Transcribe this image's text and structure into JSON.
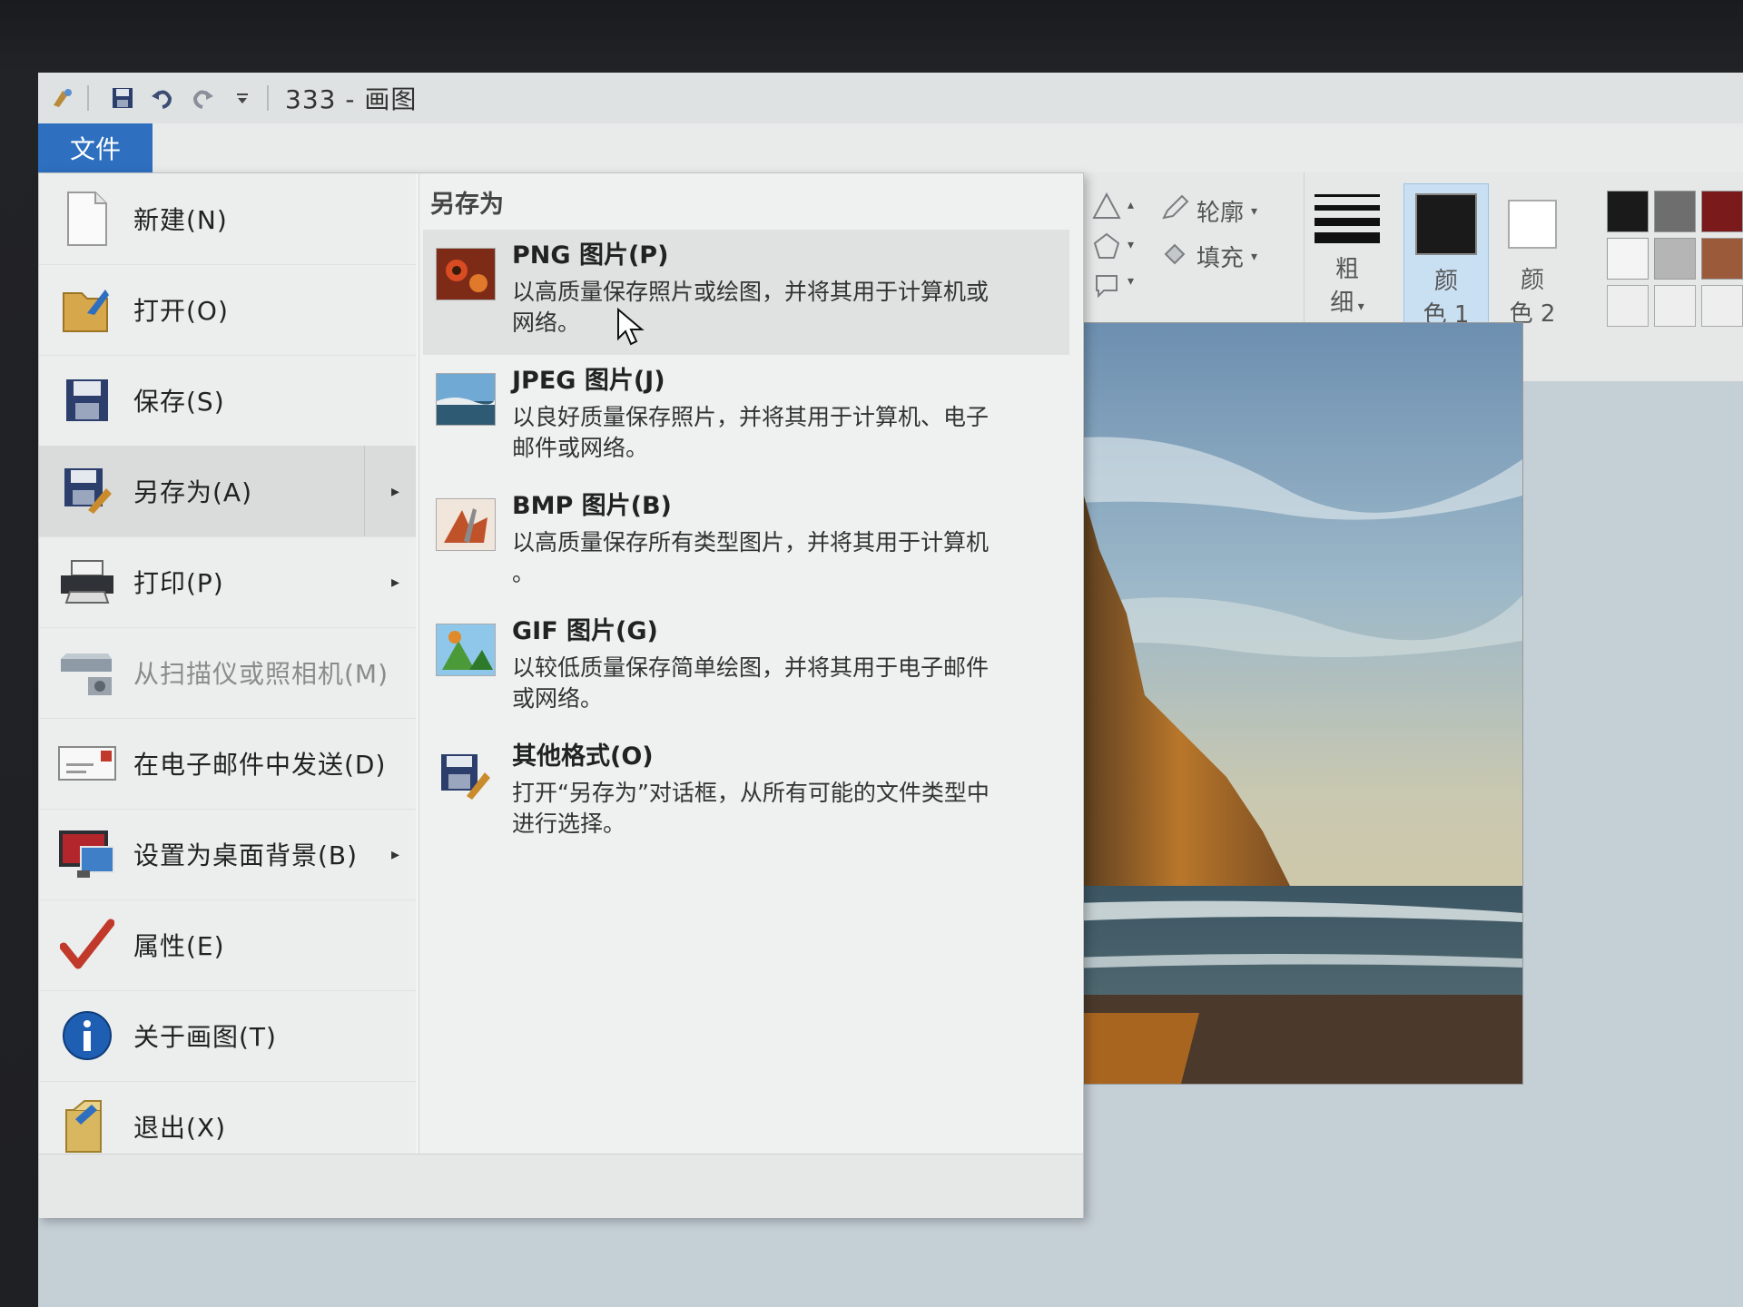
{
  "window": {
    "title": "333 - 画图"
  },
  "ribbon": {
    "file_tab": "文件",
    "outline_label": "轮廓",
    "fill_label": "填充",
    "size_label_1": "粗",
    "size_label_2": "细",
    "color1_label_1": "颜",
    "color1_label_2": "色 1",
    "color2_label_1": "颜",
    "color2_label_2": "色 2",
    "edge_text": "颜",
    "color1_value": "#1a1a1a",
    "color2_value": "#ffffff",
    "palette_row1": [
      "#1a1a1a",
      "#6e6e6e",
      "#7a1a1a",
      "#d9262b"
    ],
    "palette_row2": [
      "#f4f4f4",
      "#b5b5b5",
      "#9b5b3a",
      "#e8a7b5"
    ],
    "palette_row3": [
      "#eeeeee",
      "#eeeeee",
      "#eeeeee",
      "#eeeeee"
    ]
  },
  "file_menu": {
    "items": [
      {
        "label": "新建(N)",
        "icon": "new-document-icon",
        "has_submenu": false,
        "disabled": false
      },
      {
        "label": "打开(O)",
        "icon": "open-folder-icon",
        "has_submenu": false,
        "disabled": false
      },
      {
        "label": "保存(S)",
        "icon": "save-disk-icon",
        "has_submenu": false,
        "disabled": false
      },
      {
        "label": "另存为(A)",
        "icon": "save-as-icon",
        "has_submenu": true,
        "disabled": false
      },
      {
        "label": "打印(P)",
        "icon": "printer-icon",
        "has_submenu": true,
        "disabled": false
      },
      {
        "label": "从扫描仪或照相机(M)",
        "icon": "scanner-icon",
        "has_submenu": false,
        "disabled": true
      },
      {
        "label": "在电子邮件中发送(D)",
        "icon": "email-icon",
        "has_submenu": false,
        "disabled": false
      },
      {
        "label": "设置为桌面背景(B)",
        "icon": "desktop-background-icon",
        "has_submenu": true,
        "disabled": false
      },
      {
        "label": "属性(E)",
        "icon": "checkmark-icon",
        "has_submenu": false,
        "disabled": false
      },
      {
        "label": "关于画图(T)",
        "icon": "info-icon",
        "has_submenu": false,
        "disabled": false
      },
      {
        "label": "退出(X)",
        "icon": "exit-icon",
        "has_submenu": false,
        "disabled": false
      }
    ],
    "arrow_glyph": "▸"
  },
  "save_as": {
    "title": "另存为",
    "formats": [
      {
        "title": "PNG 图片(P)",
        "desc_line1": "以高质量保存照片或绘图，并将其用于计算机或",
        "desc_line2": "网络。",
        "icon": "png-image-icon"
      },
      {
        "title": "JPEG 图片(J)",
        "desc_line1": "以良好质量保存照片，并将其用于计算机、电子",
        "desc_line2": "邮件或网络。",
        "icon": "jpeg-image-icon"
      },
      {
        "title": "BMP 图片(B)",
        "desc_line1": "以高质量保存所有类型图片，并将其用于计算机",
        "desc_line2": "。",
        "icon": "bmp-image-icon"
      },
      {
        "title": "GIF 图片(G)",
        "desc_line1": "以较低质量保存简单绘图，并将其用于电子邮件",
        "desc_line2": "或网络。",
        "icon": "gif-image-icon"
      },
      {
        "title": "其他格式(O)",
        "desc_line1": "打开“另存为”对话框，从所有可能的文件类型中",
        "desc_line2": "进行选择。",
        "icon": "other-formats-icon"
      }
    ]
  }
}
